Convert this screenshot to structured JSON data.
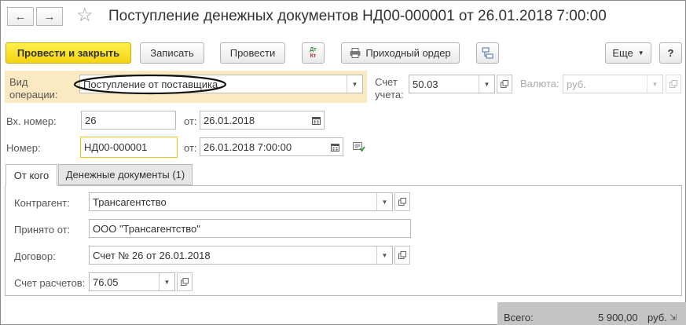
{
  "window": {
    "title": "Поступление денежных документов НД00-000001 от 26.01.2018 7:00:00",
    "back_icon": "←",
    "forward_icon": "→",
    "star_icon": "☆"
  },
  "toolbar": {
    "post_and_close": "Провести и закрыть",
    "save": "Записать",
    "post": "Провести",
    "dt_label": "Дт",
    "kt_label": "Кт",
    "receipt_order": "Приходный ордер",
    "more": "Еще",
    "help": "?"
  },
  "operation": {
    "label": "Вид операции:",
    "value": "Поступление от поставщика"
  },
  "account": {
    "label": "Счет учета:",
    "value": "50.03"
  },
  "currency": {
    "label": "Валюта:",
    "value": "руб."
  },
  "incoming_number": {
    "label": "Вх. номер:",
    "value": "26",
    "date_label": "от:",
    "date_value": "26.01.2018"
  },
  "number": {
    "label": "Номер:",
    "value": "НД00-000001",
    "date_label": "от:",
    "date_value": "26.01.2018  7:00:00"
  },
  "tabs": [
    {
      "label": "От кого"
    },
    {
      "label": "Денежные документы (1)"
    }
  ],
  "form": {
    "counterparty_label": "Контрагент:",
    "counterparty_value": "Трансагентство",
    "received_from_label": "Принято от:",
    "received_from_value": "ООО \"Трансагентство\"",
    "contract_label": "Договор:",
    "contract_value": "Счет № 26 от 26.01.2018",
    "settlement_account_label": "Счет расчетов:",
    "settlement_account_value": "76.05"
  },
  "footer": {
    "total_label": "Всего:",
    "total_value": "5 900,00",
    "total_currency": "руб."
  },
  "colors": {
    "primary_button": "#f3d513",
    "highlight_background": "#fbe9c2",
    "footer_background": "#c4c4c4"
  }
}
